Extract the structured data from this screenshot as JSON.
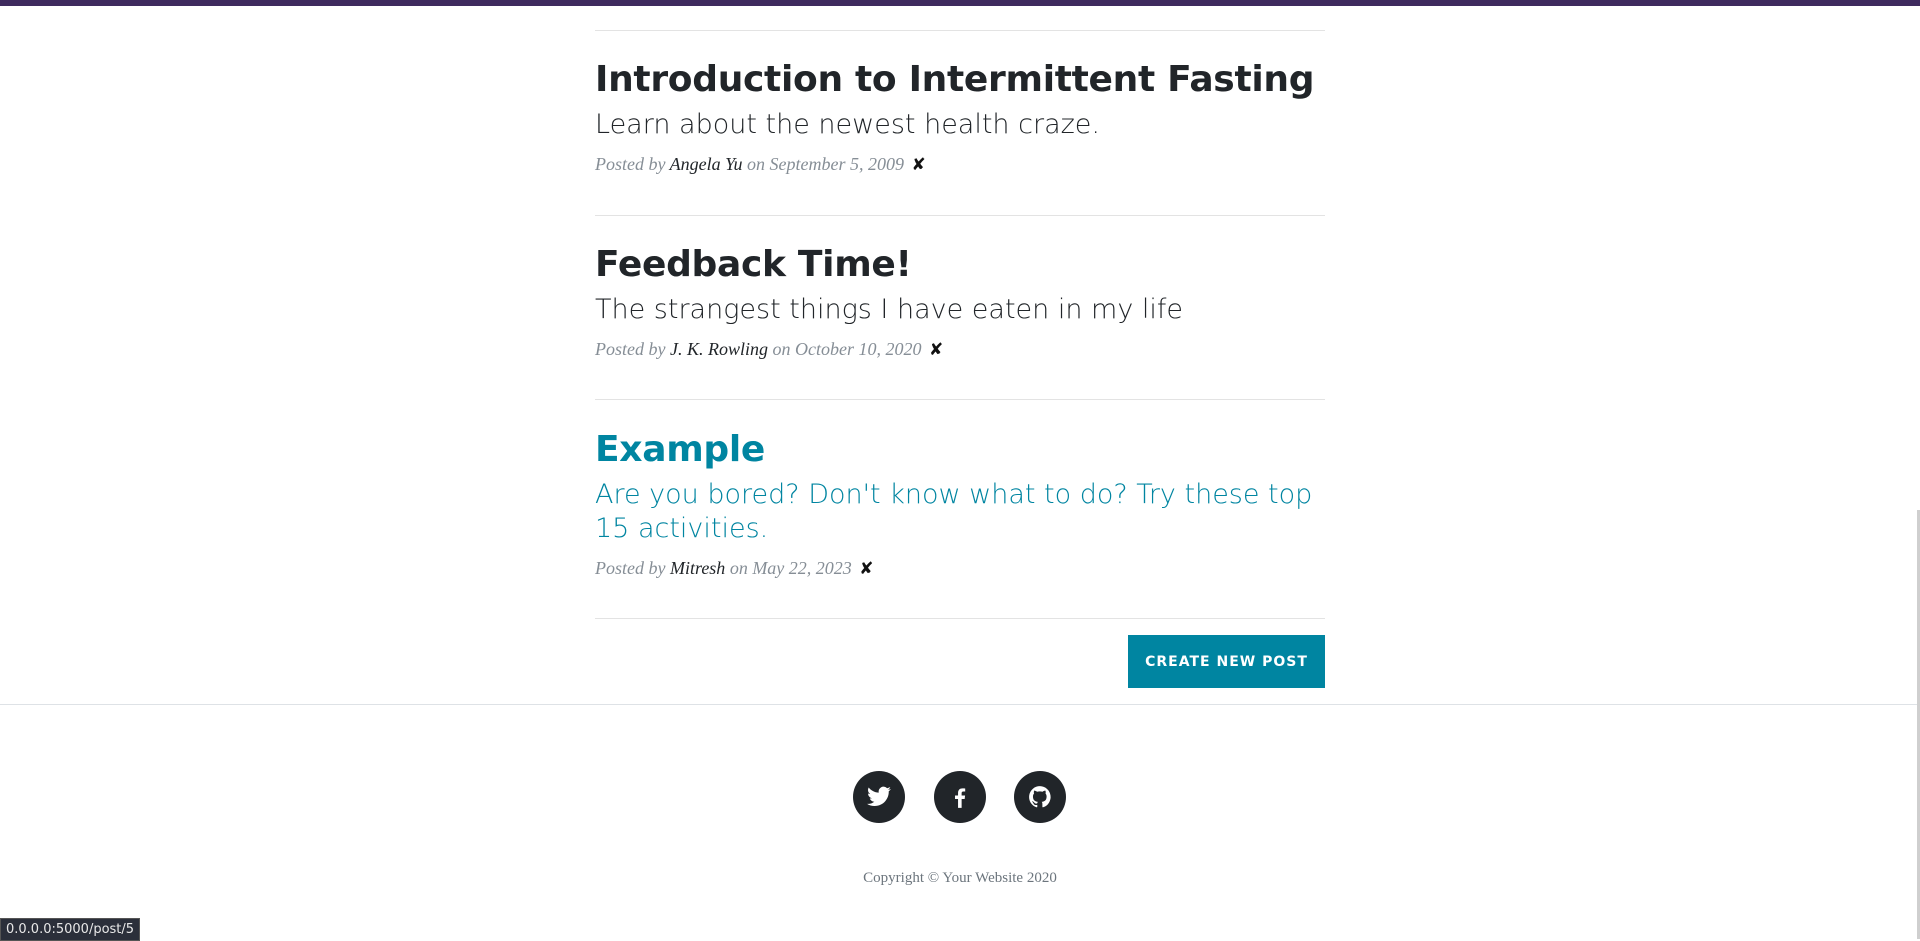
{
  "posts": [
    {
      "title": "Introduction to Intermittent Fasting",
      "subtitle": "Learn about the newest health craze.",
      "posted_by": "Posted by",
      "author": "Angela Yu",
      "on": "on",
      "date": "September 5, 2009",
      "delete_icon": "✘"
    },
    {
      "title": "Feedback Time!",
      "subtitle": "The strangest things I have eaten in my life",
      "posted_by": "Posted by",
      "author": "J. K. Rowling",
      "on": "on",
      "date": "October 10, 2020",
      "delete_icon": "✘"
    },
    {
      "title": "Example",
      "subtitle": "Are you bored? Don't know what to do? Try these top 15 activities.",
      "posted_by": "Posted by",
      "author": "Mitresh",
      "on": "on",
      "date": "May 22, 2023",
      "delete_icon": "✘"
    }
  ],
  "create_button": "Create New Post",
  "social": [
    "twitter-icon",
    "facebook-icon",
    "github-icon"
  ],
  "copyright": "Copyright © Your Website 2020",
  "status_url": "0.0.0.0:5000/post/5",
  "colors": {
    "accent": "#0085a1",
    "top_bar": "#3e2a5e",
    "dark": "#212529"
  }
}
